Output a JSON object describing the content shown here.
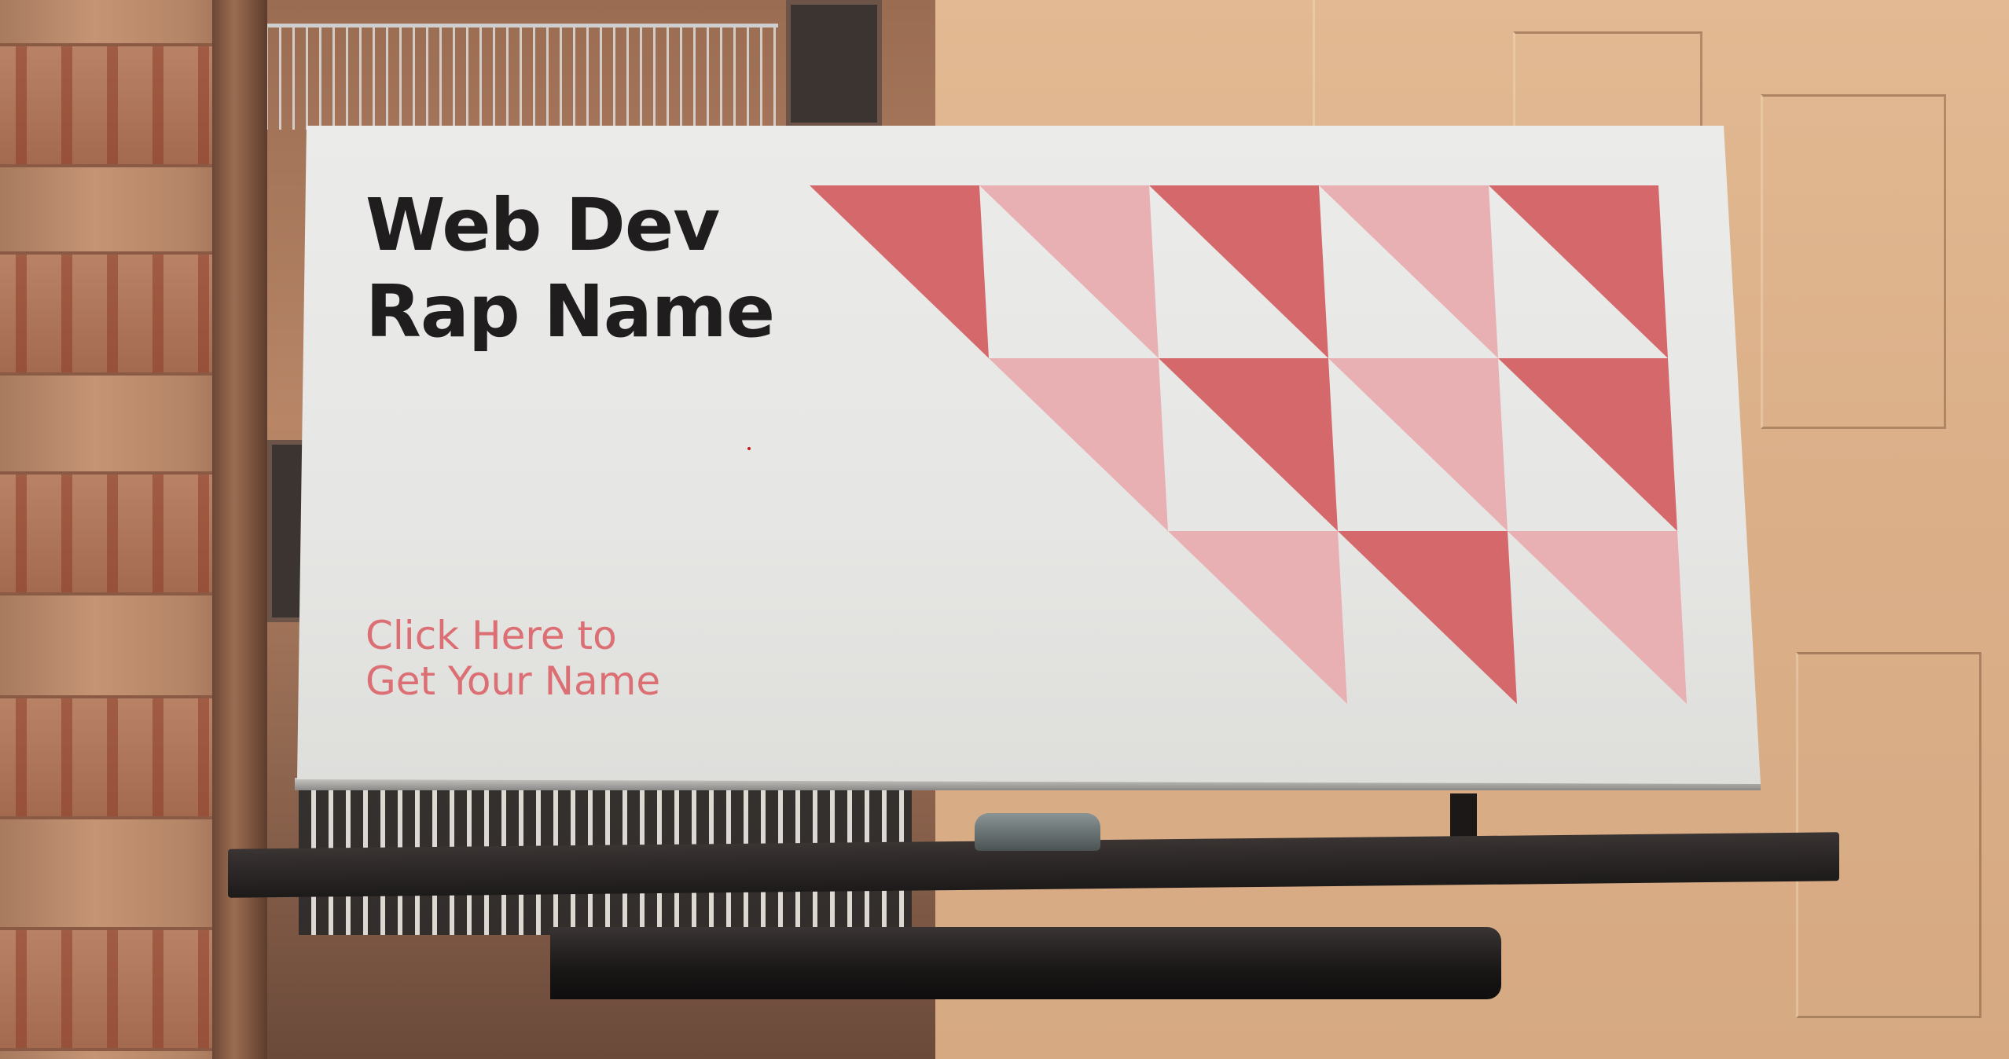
{
  "billboard": {
    "headline": [
      "Web Dev",
      "Rap Name"
    ],
    "cta": [
      "Click Here to",
      "Get Your Name"
    ]
  },
  "colors": {
    "headline": "#1f1d1d",
    "cta": "#dc6f74",
    "triangle_dark": "#d4686b",
    "triangle_light": "#e9b0b3",
    "board": "#e8e8e6"
  },
  "pattern": {
    "rows": [
      [
        "dark",
        "light",
        "dark",
        "light",
        "dark"
      ],
      [
        "light",
        "dark",
        "light",
        "dark"
      ],
      [
        "light",
        "dark",
        "light"
      ]
    ]
  }
}
